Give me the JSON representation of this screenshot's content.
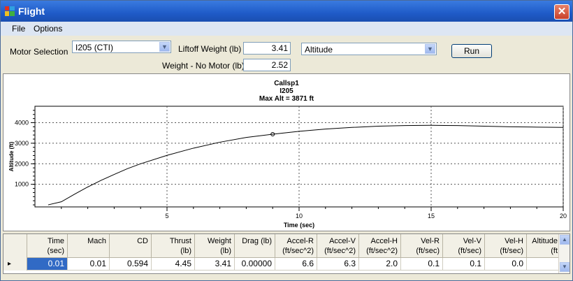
{
  "window": {
    "title": "Flight",
    "close_glyph": "✕"
  },
  "menu": {
    "items": [
      "File",
      "Options"
    ]
  },
  "controls": {
    "motor_label": "Motor Selection",
    "motor_value": "I205  (CTI)",
    "liftoff_label": "Liftoff Weight (lb)",
    "liftoff_value": "3.41",
    "nomotor_label": "Weight - No Motor (lb)",
    "nomotor_value": "2.52",
    "plot_value": "Altitude",
    "run_label": "Run"
  },
  "chart_data": {
    "type": "line",
    "title_lines": [
      "Callsp1",
      "I205",
      "Max Alt = 3871 ft"
    ],
    "xlabel": "Time (sec)",
    "ylabel": "Altitude (ft)",
    "xlim": [
      0,
      20
    ],
    "ylim": [
      -100,
      4800
    ],
    "xticks": [
      5,
      10,
      15,
      20
    ],
    "yticks": [
      1000,
      2000,
      3000,
      4000
    ],
    "grid": true,
    "x": [
      0.5,
      1,
      1.5,
      2,
      2.5,
      3,
      3.5,
      4,
      5,
      6,
      7,
      8,
      9,
      10,
      11,
      12,
      13,
      14,
      15,
      16,
      17,
      18,
      19,
      20
    ],
    "y": [
      0,
      150,
      520,
      870,
      1190,
      1480,
      1760,
      2000,
      2410,
      2760,
      3050,
      3280,
      3440,
      3580,
      3690,
      3770,
      3830,
      3860,
      3871,
      3860,
      3830,
      3800,
      3785,
      3770
    ],
    "marker": {
      "x": 9,
      "y": 3440
    }
  },
  "grid": {
    "columns": [
      "Time\n(sec)",
      "Mach",
      "CD",
      "Thrust\n(lb)",
      "Weight\n(lb)",
      "Drag (lb)",
      "Accel-R\n(ft/sec^2)",
      "Accel-V\n(ft/sec^2)",
      "Accel-H\n(ft/sec^2)",
      "Vel-R\n(ft/sec)",
      "Vel-V\n(ft/sec)",
      "Vel-H\n(ft/sec)",
      "Altitude\n(ft"
    ],
    "rows": [
      [
        "0.01",
        "0.01",
        "0.594",
        "4.45",
        "3.41",
        "0.00000",
        "6.6",
        "6.3",
        "2.0",
        "0.1",
        "0.1",
        "0.0",
        ""
      ]
    ],
    "row_indicator": "▸"
  }
}
